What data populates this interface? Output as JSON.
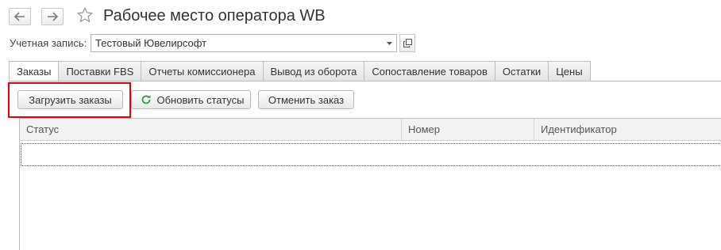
{
  "header": {
    "title": "Рабочее место оператора WB",
    "back_icon": "arrow-left-icon",
    "forward_icon": "arrow-right-icon",
    "favorite_icon": "star-outline-icon"
  },
  "account": {
    "label": "Учетная запись:",
    "value": "Тестовый Ювелирсофт",
    "dropdown_icon": "caret-down-icon",
    "open_icon": "open-form-icon"
  },
  "tabs": [
    {
      "label": "Заказы",
      "active": true
    },
    {
      "label": "Поставки FBS",
      "active": false
    },
    {
      "label": "Отчеты комиссионера",
      "active": false
    },
    {
      "label": "Вывод из оборота",
      "active": false
    },
    {
      "label": "Сопоставление товаров",
      "active": false
    },
    {
      "label": "Остатки",
      "active": false
    },
    {
      "label": "Цены",
      "active": false
    }
  ],
  "toolbar": {
    "load_label": "Загрузить заказы",
    "refresh_label": "Обновить статусы",
    "refresh_icon": "refresh-icon",
    "cancel_label": "Отменить заказ"
  },
  "table": {
    "columns": [
      "Статус",
      "Номер",
      "Идентификатор"
    ],
    "rows": []
  },
  "colors": {
    "highlight": "#e3000f",
    "refresh_icon": "#2e9e3e"
  }
}
